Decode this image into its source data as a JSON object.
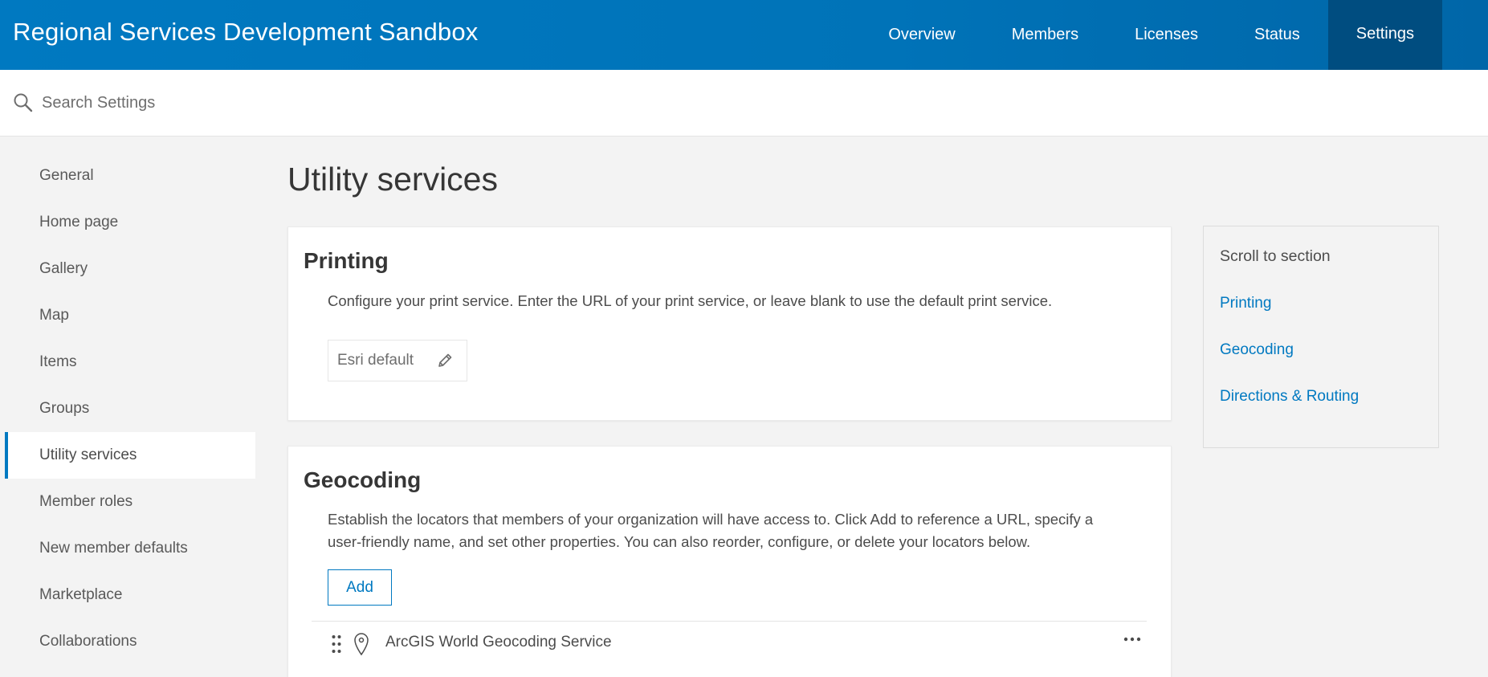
{
  "header": {
    "org_title": "Regional Services Development Sandbox",
    "nav": [
      {
        "label": "Overview",
        "active": false
      },
      {
        "label": "Members",
        "active": false
      },
      {
        "label": "Licenses",
        "active": false
      },
      {
        "label": "Status",
        "active": false
      },
      {
        "label": "Settings",
        "active": true
      }
    ]
  },
  "search": {
    "placeholder": "Search Settings",
    "icon": "search-icon"
  },
  "sidebar": {
    "items": [
      {
        "label": "General"
      },
      {
        "label": "Home page"
      },
      {
        "label": "Gallery"
      },
      {
        "label": "Map"
      },
      {
        "label": "Items"
      },
      {
        "label": "Groups"
      },
      {
        "label": "Utility services",
        "active": true
      },
      {
        "label": "Member roles"
      },
      {
        "label": "New member defaults"
      },
      {
        "label": "Marketplace"
      },
      {
        "label": "Collaborations"
      }
    ]
  },
  "main": {
    "title": "Utility services",
    "printing": {
      "heading": "Printing",
      "description": "Configure your print service. Enter the URL of your print service, or leave blank to use the default print service.",
      "service_value": "Esri default",
      "edit_icon": "pencil-icon"
    },
    "geocoding": {
      "heading": "Geocoding",
      "description": "Establish the locators that members of your organization will have access to. Click Add to reference a URL, specify a user-friendly name, and set other properties. You can also reorder, configure, or delete your locators below.",
      "add_label": "Add",
      "locators": [
        {
          "name": "ArcGIS World Geocoding Service",
          "icon": "map-pin-icon"
        }
      ]
    }
  },
  "scroll_to": {
    "title": "Scroll to section",
    "links": [
      "Printing",
      "Geocoding",
      "Directions & Routing"
    ]
  },
  "colors": {
    "brand_blue": "#0079c1",
    "active_nav": "#004d80",
    "background": "#f3f3f3"
  }
}
